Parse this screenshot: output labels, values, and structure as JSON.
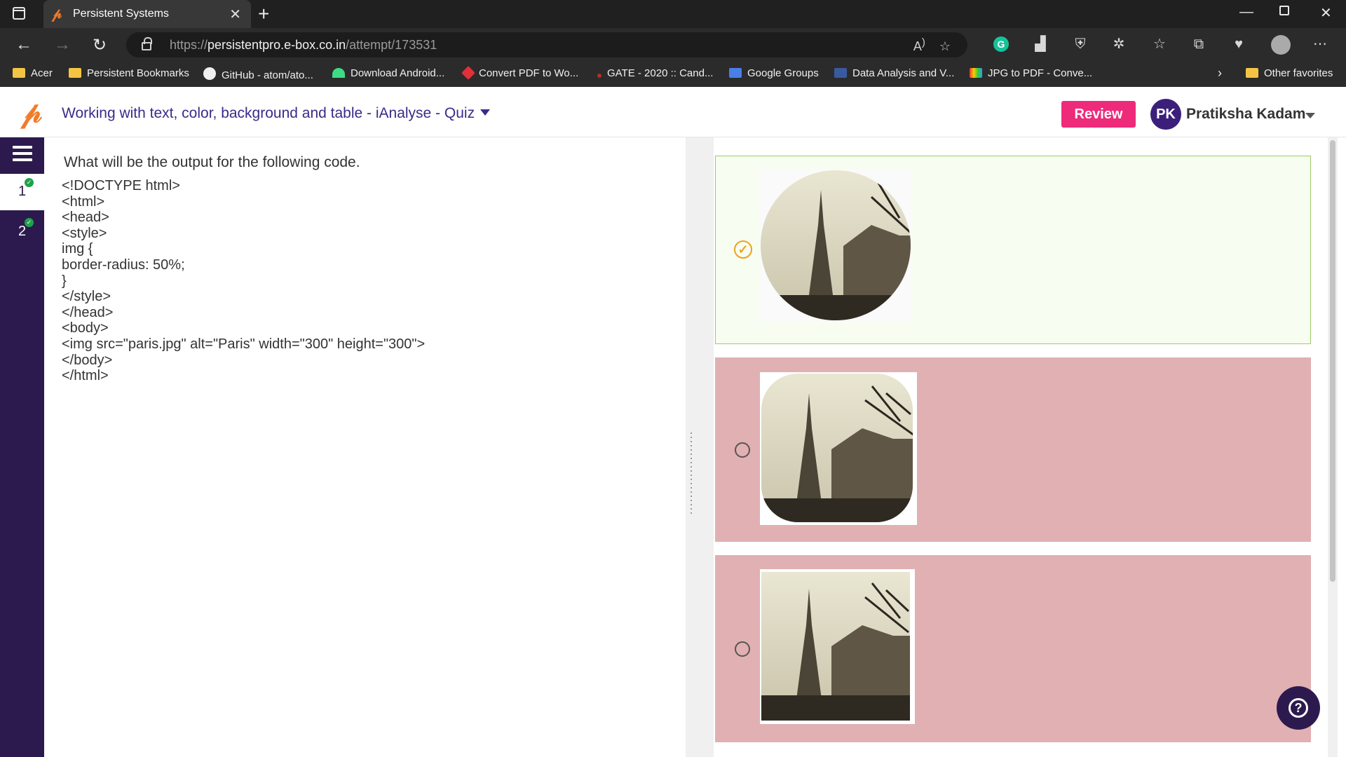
{
  "browser": {
    "tab_title": "Persistent Systems",
    "url_prefix": "https://",
    "url_host": "persistentpro.e-box.co.in",
    "url_path": "/attempt/173531",
    "bookmarks": [
      "Acer",
      "Persistent Bookmarks",
      "GitHub - atom/ato...",
      "Download Android...",
      "Convert PDF to Wo...",
      "GATE - 2020 :: Cand...",
      "Google Groups",
      "Data Analysis and V...",
      "JPG to PDF - Conve..."
    ],
    "other_favorites": "Other favorites"
  },
  "header": {
    "quiz_title": "Working with text, color, background and table - iAnalyse - Quiz",
    "review_label": "Review",
    "avatar_initials": "PK",
    "user_name": "Pratiksha Kadam"
  },
  "sidebar": {
    "questions": [
      {
        "number": "1",
        "answered": true
      },
      {
        "number": "2",
        "answered": true
      }
    ]
  },
  "question": {
    "prompt": "What will be the output for the following code.",
    "code": "<!DOCTYPE html>\n<html>\n<head>\n<style>\nimg {\nborder-radius: 50%;\n}\n</style>\n</head>\n<body>\n<img src=\"paris.jpg\" alt=\"Paris\" width=\"300\" height=\"300\">\n</body>\n</html>"
  },
  "options": [
    {
      "image": "paris-eiffel-tower-circle",
      "state": "selected"
    },
    {
      "image": "paris-eiffel-tower-rounded",
      "state": "unselected"
    },
    {
      "image": "paris-eiffel-tower-square",
      "state": "unselected"
    }
  ],
  "colors": {
    "brand_purple": "#2c1a4f",
    "title_purple": "#3b2a8a",
    "review_pink": "#ee2a7b",
    "selected_option_bg": "#f7fdf0",
    "option_bg": "#e0b0b2",
    "check_orange": "#f0a020"
  }
}
